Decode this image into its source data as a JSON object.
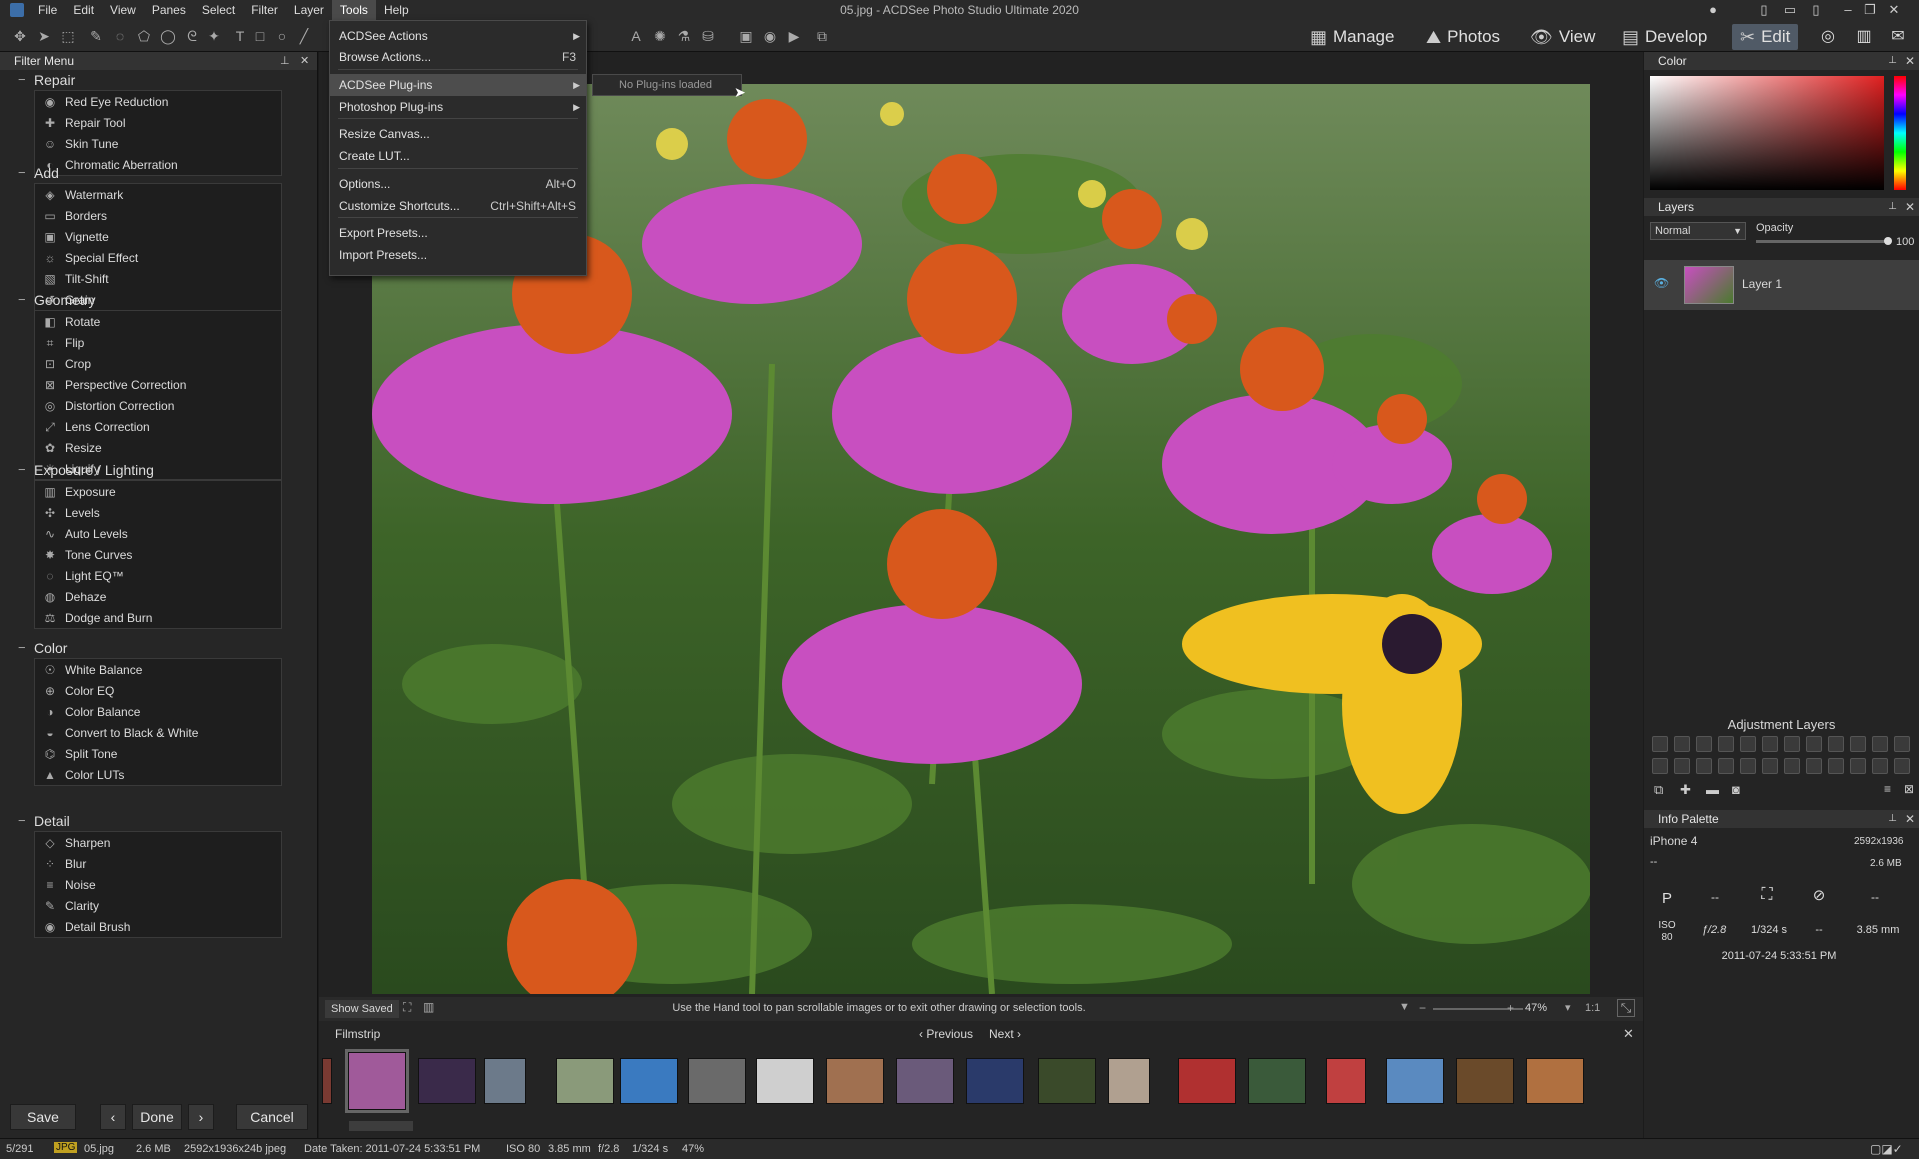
{
  "window": {
    "title": "05.jpg - ACDSee Photo Studio Ultimate 2020"
  },
  "menubar": {
    "items": [
      "File",
      "Edit",
      "View",
      "Panes",
      "Select",
      "Filter",
      "Layer",
      "Tools",
      "Help"
    ],
    "active": "Tools"
  },
  "modes": {
    "manage": "Manage",
    "photos": "Photos",
    "view": "View",
    "develop": "Develop",
    "edit": "Edit"
  },
  "tools_menu": {
    "items": [
      {
        "label": "ACDSee Actions",
        "shortcut": "",
        "submenu": true
      },
      {
        "label": "Browse Actions...",
        "shortcut": "F3",
        "submenu": false
      },
      {
        "label": "ACDSee Plug-ins",
        "shortcut": "",
        "submenu": true
      },
      {
        "label": "Photoshop Plug-ins",
        "shortcut": "",
        "submenu": true
      },
      {
        "label": "Resize Canvas...",
        "shortcut": "",
        "submenu": false
      },
      {
        "label": "Create LUT...",
        "shortcut": "",
        "submenu": false
      },
      {
        "label": "Options...",
        "shortcut": "Alt+O",
        "submenu": false
      },
      {
        "label": "Customize Shortcuts...",
        "shortcut": "Ctrl+Shift+Alt+S",
        "submenu": false
      },
      {
        "label": "Export Presets...",
        "shortcut": "",
        "submenu": false
      },
      {
        "label": "Import Presets...",
        "shortcut": "",
        "submenu": false
      }
    ],
    "submenu_text": "No Plug-ins loaded"
  },
  "filter_menu": {
    "title": "Filter Menu",
    "groups": [
      {
        "name": "Repair",
        "items": [
          "Red Eye Reduction",
          "Repair Tool",
          "Skin Tune",
          "Chromatic Aberration"
        ]
      },
      {
        "name": "Add",
        "items": [
          "Watermark",
          "Borders",
          "Vignette",
          "Special Effect",
          "Tilt-Shift",
          "Grain"
        ]
      },
      {
        "name": "Geometry",
        "items": [
          "Rotate",
          "Flip",
          "Crop",
          "Perspective Correction",
          "Distortion Correction",
          "Lens Correction",
          "Resize",
          "Liquify"
        ]
      },
      {
        "name": "Exposure / Lighting",
        "items": [
          "Exposure",
          "Levels",
          "Auto Levels",
          "Tone Curves",
          "Light EQ™",
          "Dehaze",
          "Dodge and Burn"
        ]
      },
      {
        "name": "Color",
        "items": [
          "White Balance",
          "Color EQ",
          "Color Balance",
          "Convert to Black & White",
          "Split Tone",
          "Color LUTs"
        ]
      },
      {
        "name": "Detail",
        "items": [
          "Sharpen",
          "Blur",
          "Noise",
          "Clarity",
          "Detail Brush"
        ]
      }
    ],
    "buttons": {
      "save": "Save",
      "done": "Done",
      "cancel": "Cancel"
    }
  },
  "viewstrip": {
    "show_saved": "Show Saved",
    "hint": "Use the Hand tool to pan scrollable images or to exit other drawing or selection tools.",
    "zoom": "47%",
    "ratio": "1:1"
  },
  "filmstrip": {
    "title": "Filmstrip",
    "previous": "Previous",
    "next": "Next",
    "thumb_colors": [
      "#7a3a32",
      "#a05a9a",
      "#3a2a4a",
      "#6c7a8a",
      "#8a9a7a",
      "#3a7ac0",
      "#6a6a6a",
      "#cfcfcf",
      "#a07050",
      "#6a5a7a",
      "#2a3a6a",
      "#3a4a2a",
      "#b0a090",
      "#b03030",
      "#3a5a3a",
      "#c04040",
      "#5a8ac0",
      "#6a4a2a",
      "#b07040"
    ]
  },
  "statusbar": {
    "index": "5/291",
    "format": "JPG",
    "filename": "05.jpg",
    "size": "2.6 MB",
    "dims": "2592x1936x24b jpeg",
    "date": "Date Taken: 2011-07-24 5:33:51 PM",
    "iso": "ISO 80",
    "focal": "3.85 mm",
    "aperture": "f/2.8",
    "shutter": "1/324 s",
    "zoom": "47%"
  },
  "color_panel": {
    "title": "Color"
  },
  "layers": {
    "title": "Layers",
    "blend": "Normal",
    "opacity_label": "Opacity",
    "opacity": "100",
    "layer_name": "Layer 1"
  },
  "adjustment_layers": {
    "title": "Adjustment Layers"
  },
  "info_palette": {
    "title": "Info Palette",
    "camera": "iPhone 4",
    "dims": "2592x1936",
    "dash1": "--",
    "size": "2.6 MB",
    "mode": "P",
    "dash2": "--",
    "dash3": "--",
    "iso_label": "ISO",
    "iso": "80",
    "aperture": "ƒ/2.8",
    "shutter": "1/324 s",
    "dash4": "--",
    "focal": "3.85 mm",
    "date": "2011-07-24 5:33:51 PM"
  }
}
